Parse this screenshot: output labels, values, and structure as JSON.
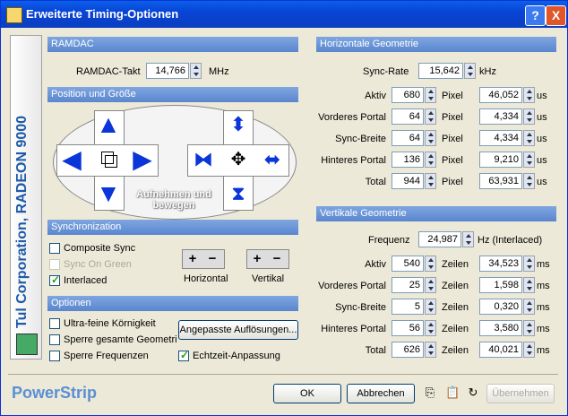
{
  "window": {
    "title": "Erweiterte Timing-Optionen",
    "help": "?",
    "close": "X"
  },
  "sidebar": {
    "text": "Tul Corporation, RADEON 9000"
  },
  "ramdac": {
    "header": "RAMDAC",
    "label": "RAMDAC-Takt",
    "value": "14,766",
    "unit": "MHz"
  },
  "position": {
    "header": "Position und Größe",
    "overlay": "Aufnehmen und bewegen"
  },
  "sync": {
    "header": "Synchronization",
    "composite": "Composite Sync",
    "sync_on_green": "Sync On Green",
    "interlaced": "Interlaced",
    "horizontal": "Horizontal",
    "vertikal": "Vertikal",
    "plus": "+",
    "minus": "−"
  },
  "optionen": {
    "header": "Optionen",
    "korn": "Ultra-feine Körnigkeit",
    "sperre_geo": "Sperre gesamte Geometri",
    "sperre_freq": "Sperre Frequenzen",
    "angepasste": "Angepasste Auflösungen...",
    "echtzeit": "Echtzeit-Anpassung"
  },
  "hgeo": {
    "header": "Horizontale Geometrie",
    "sync_rate_label": "Sync-Rate",
    "sync_rate": "15,642",
    "sync_rate_unit": "kHz",
    "unit1": "Pixel",
    "unit2": "us",
    "rows": [
      {
        "label": "Aktiv",
        "v1": "680",
        "v2": "46,052"
      },
      {
        "label": "Vorderes Portal",
        "v1": "64",
        "v2": "4,334"
      },
      {
        "label": "Sync-Breite",
        "v1": "64",
        "v2": "4,334"
      },
      {
        "label": "Hinteres Portal",
        "v1": "136",
        "v2": "9,210"
      },
      {
        "label": "Total",
        "v1": "944",
        "v2": "63,931"
      }
    ]
  },
  "vgeo": {
    "header": "Vertikale Geometrie",
    "freq_label": "Frequenz",
    "freq": "24,987",
    "freq_unit": "Hz (Interlaced)",
    "unit1": "Zeilen",
    "unit2": "ms",
    "rows": [
      {
        "label": "Aktiv",
        "v1": "540",
        "v2": "34,523"
      },
      {
        "label": "Vorderes Portal",
        "v1": "25",
        "v2": "1,598"
      },
      {
        "label": "Sync-Breite",
        "v1": "5",
        "v2": "0,320"
      },
      {
        "label": "Hinteres Portal",
        "v1": "56",
        "v2": "3,580"
      },
      {
        "label": "Total",
        "v1": "626",
        "v2": "40,021"
      }
    ]
  },
  "footer": {
    "brand": "PowerStrip",
    "ok": "OK",
    "cancel": "Abbrechen",
    "uebernehmen": "Übernehmen"
  },
  "icons": [
    "app-icon",
    "copy-icon",
    "paste-icon",
    "refresh-icon",
    "move-icon"
  ]
}
